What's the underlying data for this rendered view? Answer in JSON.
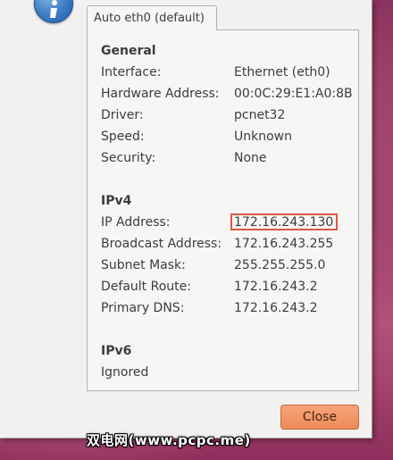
{
  "tab": {
    "label": "Auto eth0 (default)"
  },
  "general": {
    "title": "General",
    "rows": [
      {
        "label": "Interface:",
        "value": "Ethernet (eth0)"
      },
      {
        "label": "Hardware Address:",
        "value": "00:0C:29:E1:A0:8B"
      },
      {
        "label": "Driver:",
        "value": "pcnet32"
      },
      {
        "label": "Speed:",
        "value": "Unknown"
      },
      {
        "label": "Security:",
        "value": "None"
      }
    ]
  },
  "ipv4": {
    "title": "IPv4",
    "rows": [
      {
        "label": "IP Address:",
        "value": "172.16.243.130"
      },
      {
        "label": "Broadcast Address:",
        "value": "172.16.243.255"
      },
      {
        "label": "Subnet Mask:",
        "value": "255.255.255.0"
      },
      {
        "label": "Default Route:",
        "value": "172.16.243.2"
      },
      {
        "label": "Primary DNS:",
        "value": "172.16.243.2"
      }
    ]
  },
  "ipv6": {
    "title": "IPv6",
    "status": "Ignored"
  },
  "buttons": {
    "close": "Close"
  },
  "watermark": {
    "text": "双电网(www.pcpc.me)"
  },
  "icons": {
    "dialog_icon": "info-icon"
  },
  "colors": {
    "highlight": "#e0573f",
    "close_button": "#ee8a58",
    "info_icon": "#3a7bc2"
  }
}
